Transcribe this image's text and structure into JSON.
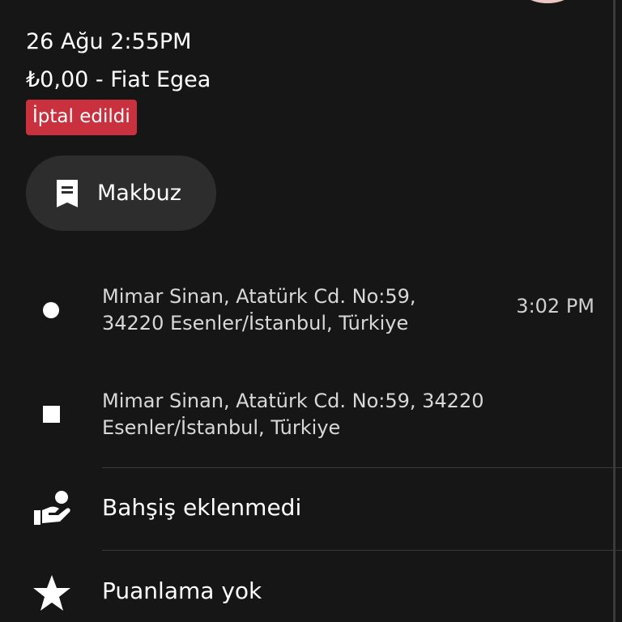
{
  "trip": {
    "date_time": "26 Ağu 2:55PM",
    "price_vehicle": "₺0,00 - Fiat Egea",
    "status_badge": "İptal edildi"
  },
  "receipt_button": {
    "label": "Makbuz"
  },
  "route": {
    "pickup": {
      "line1": "Mimar Sinan, Atatürk Cd. No:59,",
      "line2": "34220 Esenler/İstanbul, Türkiye",
      "time": "3:02 PM"
    },
    "dropoff": {
      "line1": "Mimar Sinan, Atatürk Cd. No:59, 34220",
      "line2": "Esenler/İstanbul, Türkiye"
    }
  },
  "tip_row": {
    "label": "Bahşiş eklenmedi",
    "icon": "hand-coin-icon"
  },
  "rating_row": {
    "label": "Puanlama yok",
    "icon": "star-icon"
  },
  "colors": {
    "background": "#161616",
    "badge": "#c8313d",
    "button": "#2d2d2d"
  }
}
